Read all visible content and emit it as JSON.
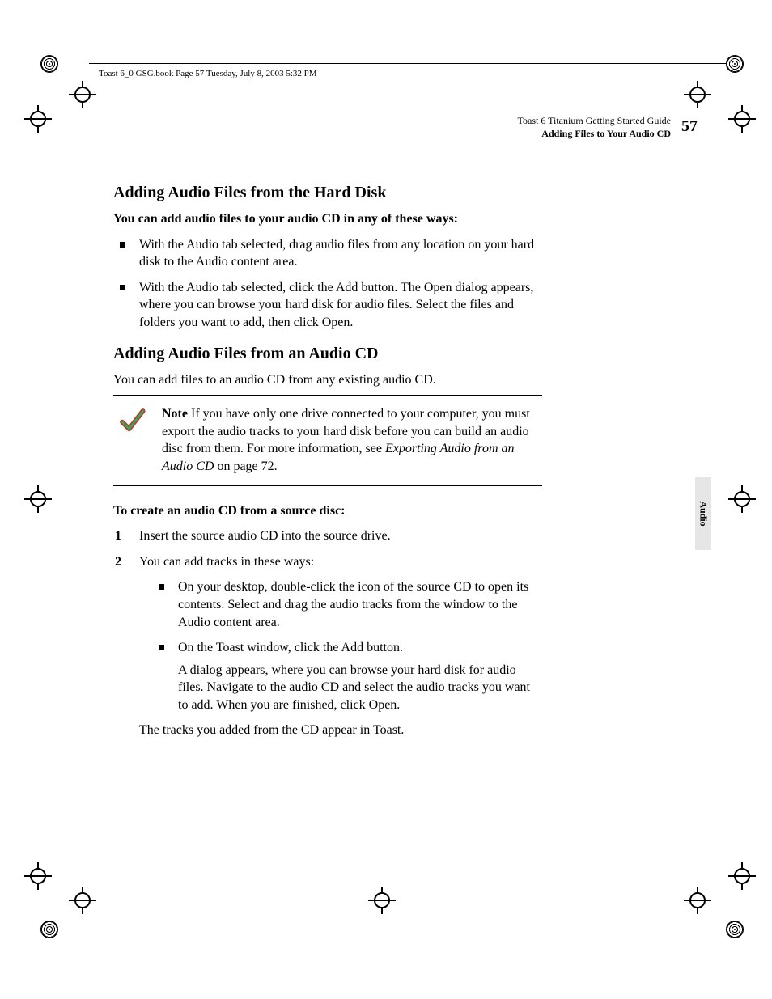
{
  "slug": "Toast 6_0 GSG.book  Page 57  Tuesday, July 8, 2003  5:32 PM",
  "running_head": {
    "line1": "Toast 6 Titanium Getting Started Guide",
    "line2": "Adding Files to Your Audio CD"
  },
  "page_number": "57",
  "side_tab": "Audio",
  "section1": {
    "heading": "Adding Audio Files from the Hard Disk",
    "intro_bold": "You can add audio files to your audio CD in any of these ways:",
    "bullets": [
      "With the Audio tab selected, drag audio files from any location on your hard disk to the Audio content area.",
      "With the Audio tab selected, click the Add button. The Open dialog appears, where you can browse your hard disk for audio files. Select the files and folders you want to add, then click Open."
    ]
  },
  "section2": {
    "heading": "Adding Audio Files from an Audio CD",
    "intro": "You can add files to an audio CD from any existing audio CD.",
    "note": {
      "label": "Note",
      "body_before_xref": " If you have only one drive connected to your computer, you must export the audio tracks to your hard disk before you can build an audio disc from them. For more information, see ",
      "xref_italic": "Exporting Audio from an Audio CD",
      "body_after_xref": " on page 72."
    },
    "task_lead": "To create an audio CD from a source disc:",
    "steps": {
      "s1": "Insert the source audio CD into the source drive.",
      "s2_lead": "You can add tracks in these ways:",
      "s2_bullets": {
        "b1": "On your desktop, double-click the icon of the source CD to open its contents. Select and drag the audio tracks from the window to the Audio content area.",
        "b2": "On the Toast window, click the Add button.",
        "b2_follow": "A dialog appears, where you can browse your hard disk for audio files. Navigate to the audio CD and select the audio tracks you want to add. When you are finished, click Open."
      },
      "closing": "The tracks you added from the CD appear in Toast."
    }
  }
}
